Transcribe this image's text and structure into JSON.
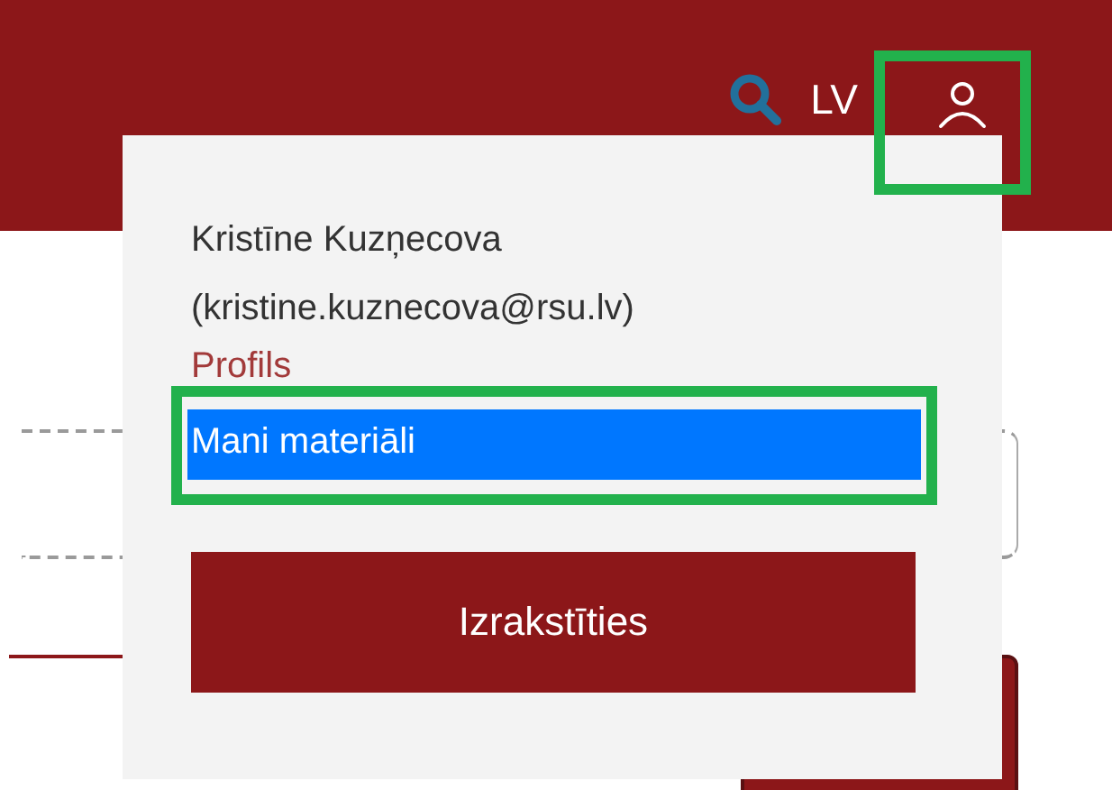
{
  "header": {
    "language": "LV",
    "user_button": {
      "highlighted": true
    }
  },
  "user_menu": {
    "name": "Kristīne Kuzņecova",
    "email": "(kristine.kuznecova@rsu.lv)",
    "items": [
      {
        "label": "Profils",
        "selected": false,
        "highlighted": false
      },
      {
        "label": "Mani materiāli",
        "selected": true,
        "highlighted": true
      }
    ],
    "logout_button": "Izrakstīties"
  }
}
